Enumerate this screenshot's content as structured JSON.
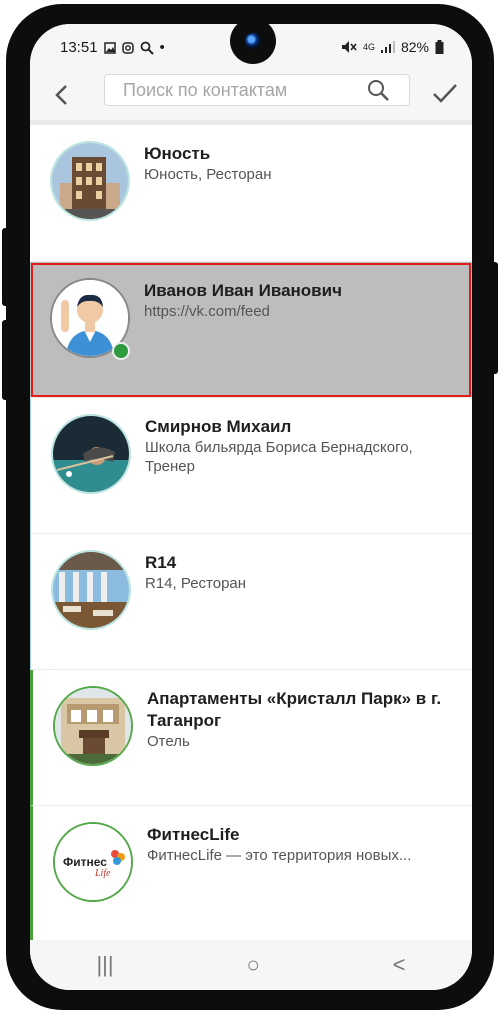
{
  "status": {
    "time": "13:51",
    "dot": "•",
    "network": "4G",
    "battery": "82%"
  },
  "toolbar": {
    "search_placeholder": "Поиск по контактам"
  },
  "contacts": [
    {
      "name": "Юность",
      "subtitle": "Юность, Ресторан"
    },
    {
      "name": "Иванов Иван Иванович",
      "subtitle": "https://vk.com/feed"
    },
    {
      "name": "Смирнов Михаил",
      "subtitle": "Школа бильярда Бориса Бернадского, Тренер"
    },
    {
      "name": "R14",
      "subtitle": "R14, Ресторан"
    },
    {
      "name": "Апартаменты «Кристалл Парк» в г. Таганрог",
      "subtitle": "Отель"
    },
    {
      "name": "ФитнесLife",
      "subtitle": "ФитнесLife — это территория новых..."
    }
  ],
  "logo_text": "Фитнес Life",
  "nav": {
    "recent": "|||",
    "home": "○",
    "back": "<"
  }
}
